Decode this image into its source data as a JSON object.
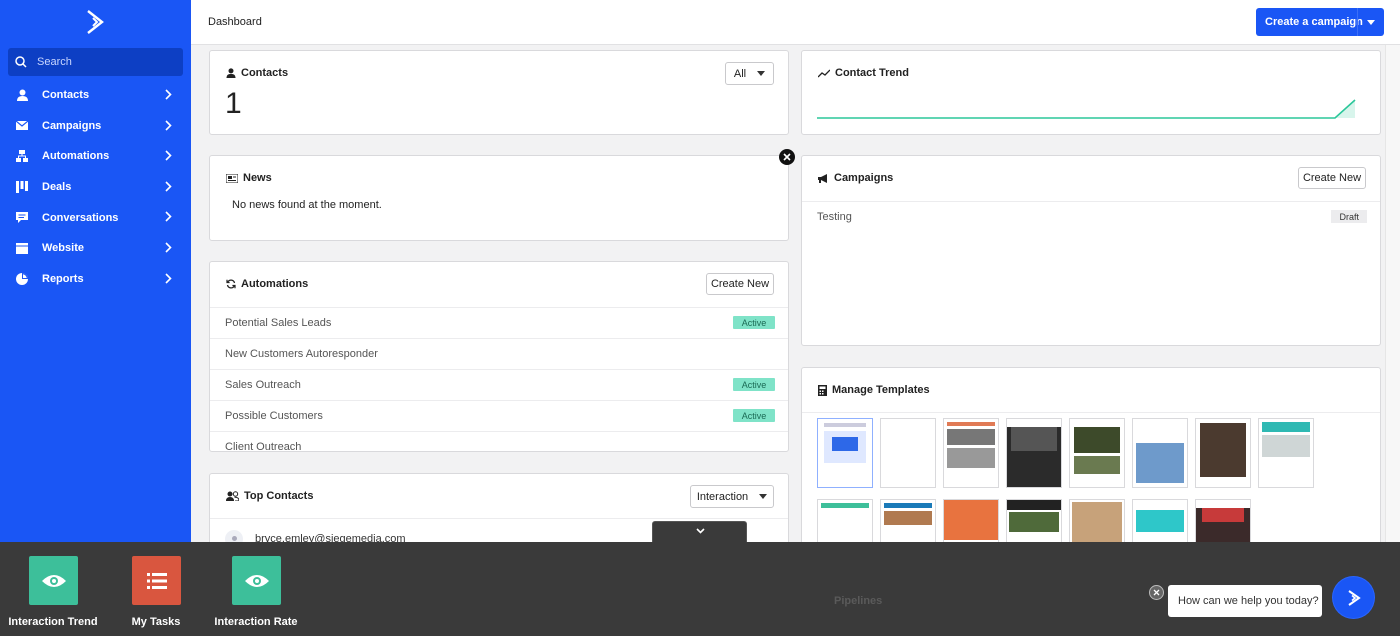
{
  "header": {
    "title": "Dashboard",
    "primary_button": "Create a campaign"
  },
  "sidebar": {
    "search_placeholder": "Search",
    "items": [
      {
        "label": "Contacts"
      },
      {
        "label": "Campaigns"
      },
      {
        "label": "Automations"
      },
      {
        "label": "Deals"
      },
      {
        "label": "Conversations"
      },
      {
        "label": "Website"
      },
      {
        "label": "Reports"
      }
    ]
  },
  "contacts_card": {
    "title": "Contacts",
    "count": "1",
    "filter": "All"
  },
  "trend_card": {
    "title": "Contact Trend"
  },
  "news_card": {
    "title": "News",
    "message": "No news found at the moment."
  },
  "campaigns_card": {
    "title": "Campaigns",
    "create_label": "Create New",
    "rows": [
      {
        "name": "Testing",
        "status": "Draft"
      }
    ]
  },
  "automations_card": {
    "title": "Automations",
    "create_label": "Create New",
    "rows": [
      {
        "name": "Potential Sales Leads",
        "status": "Active"
      },
      {
        "name": "New Customers Autoresponder",
        "status": ""
      },
      {
        "name": "Sales Outreach",
        "status": "Active"
      },
      {
        "name": "Possible Customers",
        "status": "Active"
      },
      {
        "name": "Client Outreach",
        "status": ""
      }
    ]
  },
  "templates_card": {
    "title": "Manage Templates"
  },
  "top_contacts_card": {
    "title": "Top Contacts",
    "filter": "Interaction",
    "rows": [
      {
        "email": "bryce.emley@siegemedia.com"
      }
    ]
  },
  "bottom_bar": {
    "tiles": [
      {
        "label": "Interaction Trend",
        "color": "#3dbf9a"
      },
      {
        "label": "My Tasks",
        "color": "#d9563f"
      },
      {
        "label": "Interaction Rate",
        "color": "#3dbf9a"
      }
    ]
  },
  "pipelines_faded": "Pipelines",
  "chat": {
    "prompt": "How can we help you today?"
  },
  "colors": {
    "brand": "#1a56f5",
    "active_badge": "#7fe3c8",
    "trend_line": "#2bc79a"
  }
}
